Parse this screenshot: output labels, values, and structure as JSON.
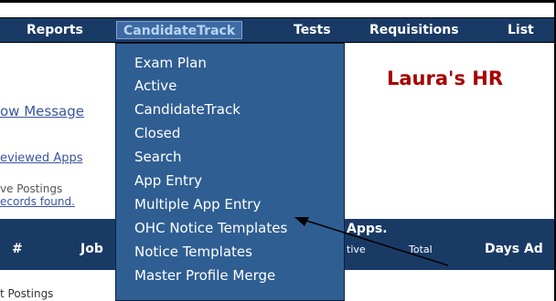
{
  "nav": {
    "items": [
      "Reports",
      "CandidateTrack",
      "Tests",
      "Requisitions",
      "List"
    ],
    "active": "CandidateTrack"
  },
  "left_links": {
    "message": "ow Message",
    "reviewed": "eviewed Apps",
    "postings": "ve Postings",
    "records": "ecords found.",
    "bottom": "t Postings"
  },
  "title": "Laura's HR",
  "table_header": {
    "hash": "#",
    "job": "Job",
    "apps": "Apps.",
    "active": "tive",
    "total": "Total",
    "days": "Days Ad"
  },
  "menu": {
    "items": [
      "Exam Plan",
      "Active",
      "CandidateTrack",
      "Closed",
      "Search",
      "App Entry",
      "Multiple App Entry",
      "OHC Notice Templates",
      "Notice Templates",
      "Master Profile Merge"
    ]
  },
  "colors": {
    "nav_bg": "#1a3a66",
    "menu_bg": "#2f5e92",
    "title": "#a80000",
    "link": "#3b55a0"
  }
}
